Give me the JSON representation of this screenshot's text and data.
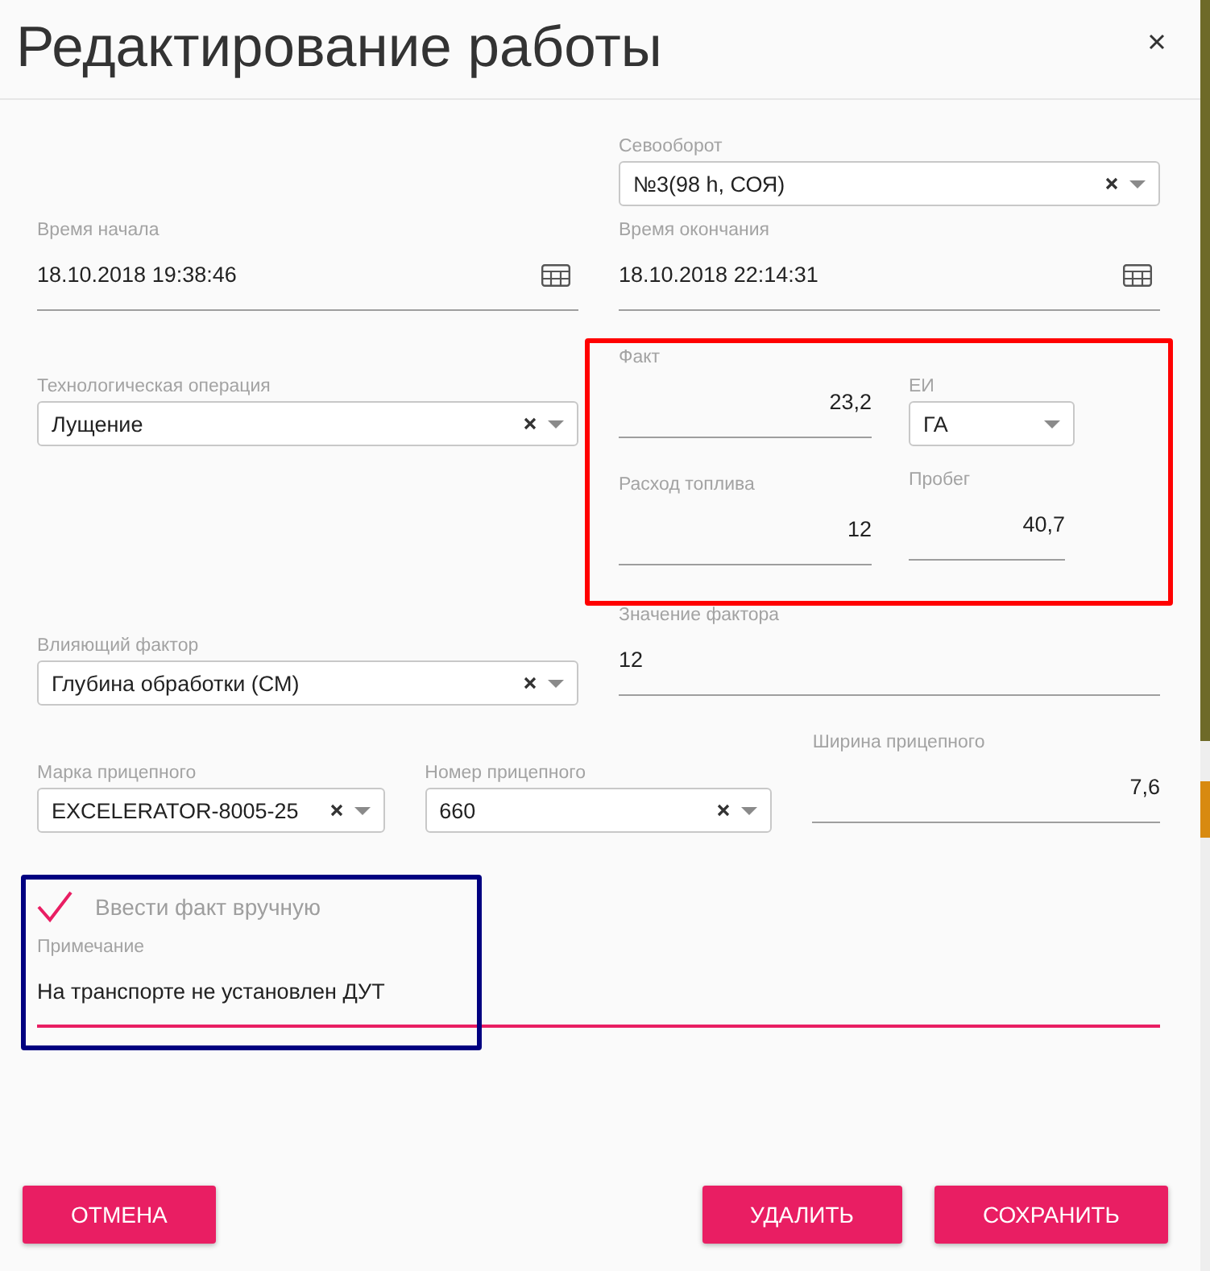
{
  "window": {
    "title": "Редактирование работы"
  },
  "crop_rotation": {
    "label": "Севооборот",
    "value": "№3(98 h, СОЯ)",
    "clearable": true
  },
  "start_time": {
    "label": "Время начала",
    "value": "18.10.2018 19:38:46"
  },
  "end_time": {
    "label": "Время окончания",
    "value": "18.10.2018 22:14:31"
  },
  "operation": {
    "label": "Технологическая операция",
    "value": "Лущение",
    "clearable": true
  },
  "fact_group": {
    "highlight": {
      "color": "#ff0000"
    },
    "fact": {
      "label": "Факт",
      "value": "23,2"
    },
    "unit": {
      "label": "ЕИ",
      "value": "ГА",
      "clearable": false
    },
    "fuel_consumption": {
      "label": "Расход топлива",
      "value": "12"
    },
    "mileage": {
      "label": "Пробег",
      "value": "40,7"
    }
  },
  "influencing_factor": {
    "label": "Влияющий фактор",
    "value": "Глубина обработки (СМ)",
    "clearable": true
  },
  "factor_value": {
    "label": "Значение фактора",
    "value": "12"
  },
  "trailer_brand": {
    "label": "Марка прицепного",
    "value": "EXCELERATOR-8005-25",
    "clearable": true
  },
  "trailer_number": {
    "label": "Номер прицепного",
    "value": "660",
    "clearable": true
  },
  "trailer_width": {
    "label": "Ширина прицепного",
    "value": "7,6"
  },
  "manual_group": {
    "highlight": {
      "color": "#000080"
    },
    "manual_fact": {
      "label": "Ввести факт вручную",
      "checked": true
    },
    "note": {
      "label": "Примечание",
      "value": "На транспорте не установлен ДУТ",
      "focused": true
    }
  },
  "footer": {
    "left_buttons": [
      {
        "label": "ОТМЕНА"
      }
    ],
    "right_buttons": [
      {
        "label": "УДАЛИТЬ"
      },
      {
        "label": "СОХРАНИТЬ"
      }
    ]
  }
}
